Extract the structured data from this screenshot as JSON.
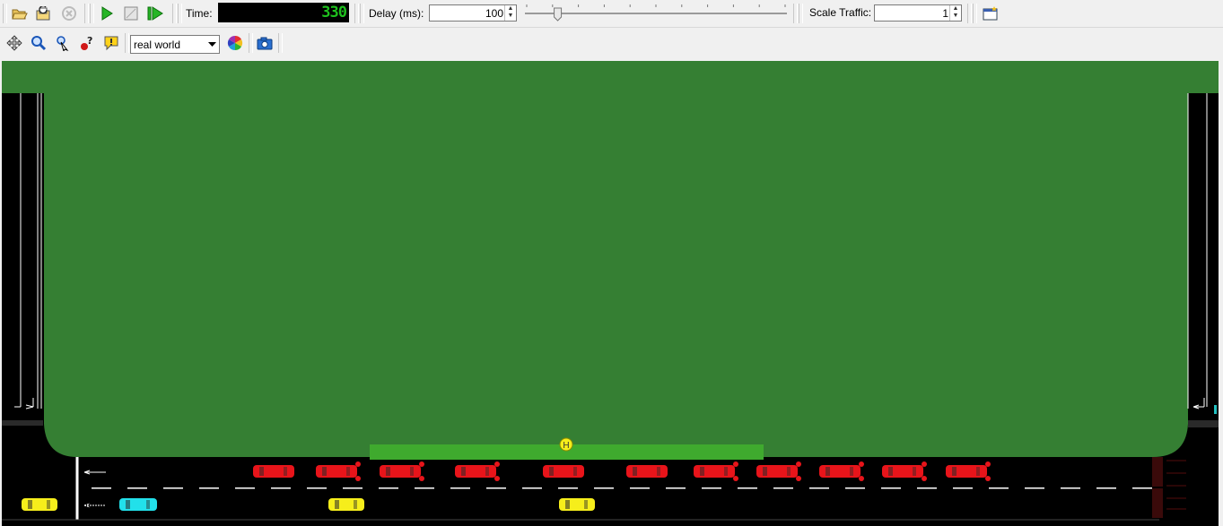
{
  "toolbar_main": {
    "open_icon": "folder-open-icon",
    "reload_icon": "reload-icon",
    "close_icon": "close-network-icon",
    "run_icon": "play-icon",
    "stop_icon": "stop-icon",
    "step_icon": "step-icon",
    "time_label": "Time:",
    "time_value": "330",
    "delay_label": "Delay (ms):",
    "delay_value": "100",
    "delay_slider_fraction": 0.12,
    "scale_label": "Scale Traffic:",
    "scale_value": "1",
    "new_view_icon": "new-view-icon"
  },
  "toolbar_view": {
    "recenter_icon": "recenter-icon",
    "locate_icon": "magnifier-icon",
    "locate_junction_icon": "locate-icon",
    "inspect_icon": "inspect-icon",
    "breakpoint_icon": "info-bubble-icon",
    "scheme_value": "real world",
    "color_icon": "color-wheel-icon",
    "screenshot_icon": "camera-icon"
  },
  "colors": {
    "grass": "#357f33",
    "bus_stop": "#3faa2e",
    "road": "#000000",
    "car_red": "#e8141a",
    "car_yellow": "#f6ee1b",
    "car_cyan": "#22e0ea",
    "clock_digits": "#1ec01e"
  },
  "scene": {
    "bus_stop_label": "H"
  }
}
